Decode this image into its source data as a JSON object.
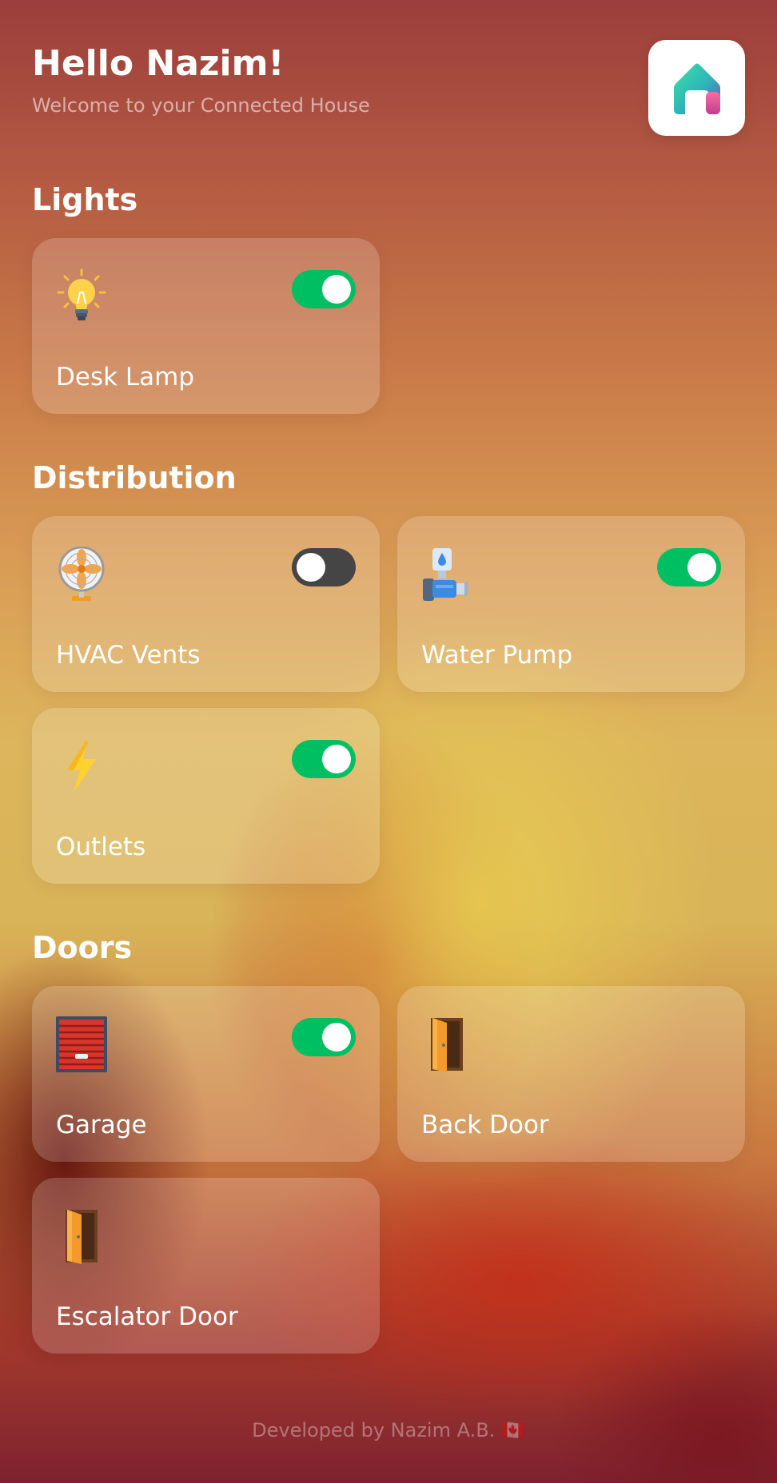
{
  "header": {
    "greeting": "Hello Nazim!",
    "subtitle": "Welcome to your Connected House",
    "logo_icon": "house-logo-icon"
  },
  "sections": {
    "lights": {
      "title": "Lights",
      "devices": [
        {
          "label": "Desk Lamp",
          "icon": "light-bulb-icon",
          "on": true
        }
      ]
    },
    "distribution": {
      "title": "Distribution",
      "devices": [
        {
          "label": "HVAC Vents",
          "icon": "fan-icon",
          "on": false
        },
        {
          "label": "Water Pump",
          "icon": "water-pump-icon",
          "on": true
        },
        {
          "label": "Outlets",
          "icon": "lightning-bolt-icon",
          "on": true
        }
      ]
    },
    "doors": {
      "title": "Doors",
      "devices": [
        {
          "label": "Garage",
          "icon": "garage-door-icon",
          "on": true
        },
        {
          "label": "Back Door",
          "icon": "door-icon"
        },
        {
          "label": "Escalator Door",
          "icon": "door-icon"
        }
      ]
    }
  },
  "footer": {
    "text": "Developed by Nazim A.B. 🇨🇦"
  },
  "colors": {
    "toggle_on": "#00bf63",
    "toggle_off": "#454545",
    "card_bg": "rgba(255,255,255,0.18)"
  }
}
